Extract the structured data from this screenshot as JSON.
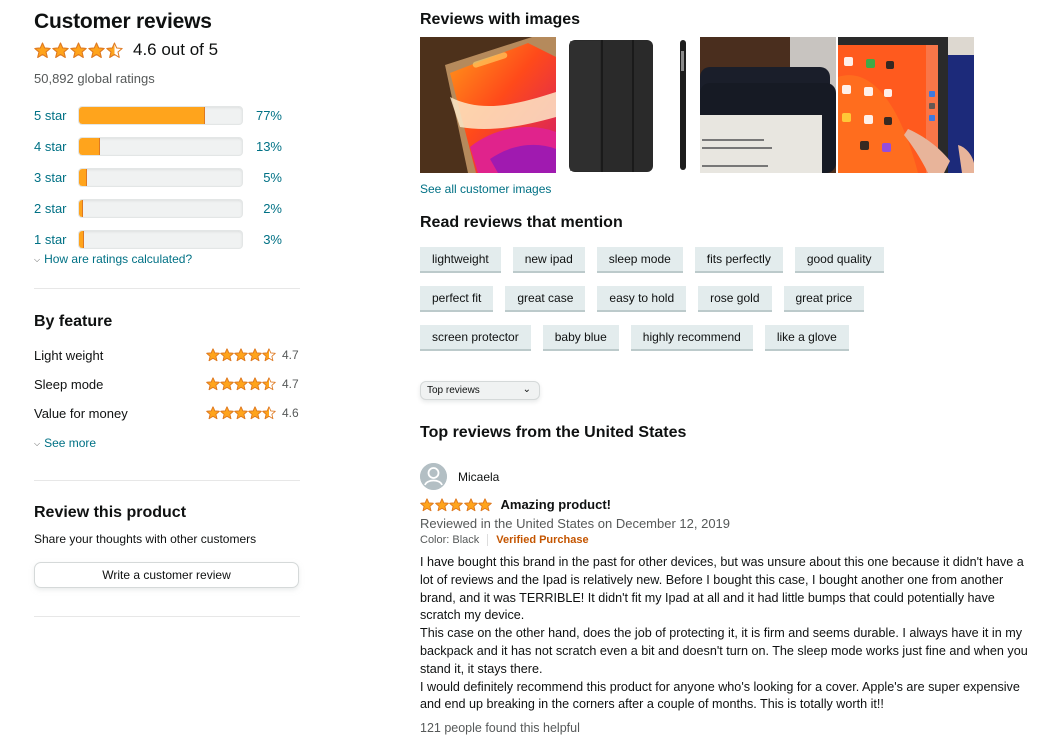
{
  "left": {
    "title": "Customer reviews",
    "overall_rating": 4.6,
    "overall_text": "4.6 out of 5",
    "global_ratings": "50,892 global ratings",
    "histogram": [
      {
        "label": "5 star",
        "percent": 77,
        "percent_text": "77%"
      },
      {
        "label": "4 star",
        "percent": 13,
        "percent_text": "13%"
      },
      {
        "label": "3 star",
        "percent": 5,
        "percent_text": "5%"
      },
      {
        "label": "2 star",
        "percent": 2,
        "percent_text": "2%"
      },
      {
        "label": "1 star",
        "percent": 3,
        "percent_text": "3%"
      }
    ],
    "how_calculated": "How are ratings calculated?",
    "by_feature": {
      "title": "By feature",
      "items": [
        {
          "name": "Light weight",
          "rating": 4.7,
          "value": "4.7"
        },
        {
          "name": "Sleep mode",
          "rating": 4.7,
          "value": "4.7"
        },
        {
          "name": "Value for money",
          "rating": 4.6,
          "value": "4.6"
        }
      ],
      "see_more": "See more"
    },
    "review_product": {
      "title": "Review this product",
      "subtitle": "Share your thoughts with other customers",
      "button": "Write a customer review"
    }
  },
  "right": {
    "images_title": "Reviews with images",
    "images": [
      {
        "alt": "iPad with rose gold case showing orange wallpaper"
      },
      {
        "alt": "Black folio case front and side view"
      },
      {
        "alt": "iPad in dark case showing e-reader text"
      },
      {
        "alt": "iPad in case with home screen apps"
      }
    ],
    "see_all_images": "See all customer images",
    "mentions_title": "Read reviews that mention",
    "mentions": [
      [
        "lightweight",
        "new ipad",
        "sleep mode",
        "fits perfectly",
        "good quality"
      ],
      [
        "perfect fit",
        "great case",
        "easy to hold",
        "rose gold",
        "great price"
      ],
      [
        "screen protector",
        "baby blue",
        "highly recommend",
        "like a glove"
      ]
    ],
    "sort": {
      "selected": "Top reviews"
    },
    "top_reviews_title": "Top reviews from the United States",
    "review": {
      "author": "Micaela",
      "rating": 5,
      "title": "Amazing product!",
      "date": "Reviewed in the United States on December 12, 2019",
      "color": "Color: Black",
      "verified": "Verified Purchase",
      "body": [
        "I have bought this brand in the past for other devices, but was unsure about this one because it didn't have a lot of reviews and the Ipad is relatively new. Before I bought this case, I bought another one from another brand, and it was TERRIBLE! It didn't fit my Ipad at all and it had little bumps that could potentially have scratch my device.",
        "This case on the other hand, does the job of protecting it, it is firm and seems durable. I always have it in my backpack and it has not scratch even a bit and doesn't turn on. The sleep mode works just fine and when you stand it, it stays there.",
        "I would definitely recommend this product for anyone who's looking for a cover. Apple's are super expensive and end up breaking in the corners after a couple of months. This is totally worth it!!"
      ],
      "helpful": "121 people found this helpful"
    }
  },
  "colors": {
    "star": "#ffa41c",
    "star_stroke": "#de7921",
    "link": "#007185",
    "chip_bg": "#e3eced",
    "verified": "#c45500"
  }
}
